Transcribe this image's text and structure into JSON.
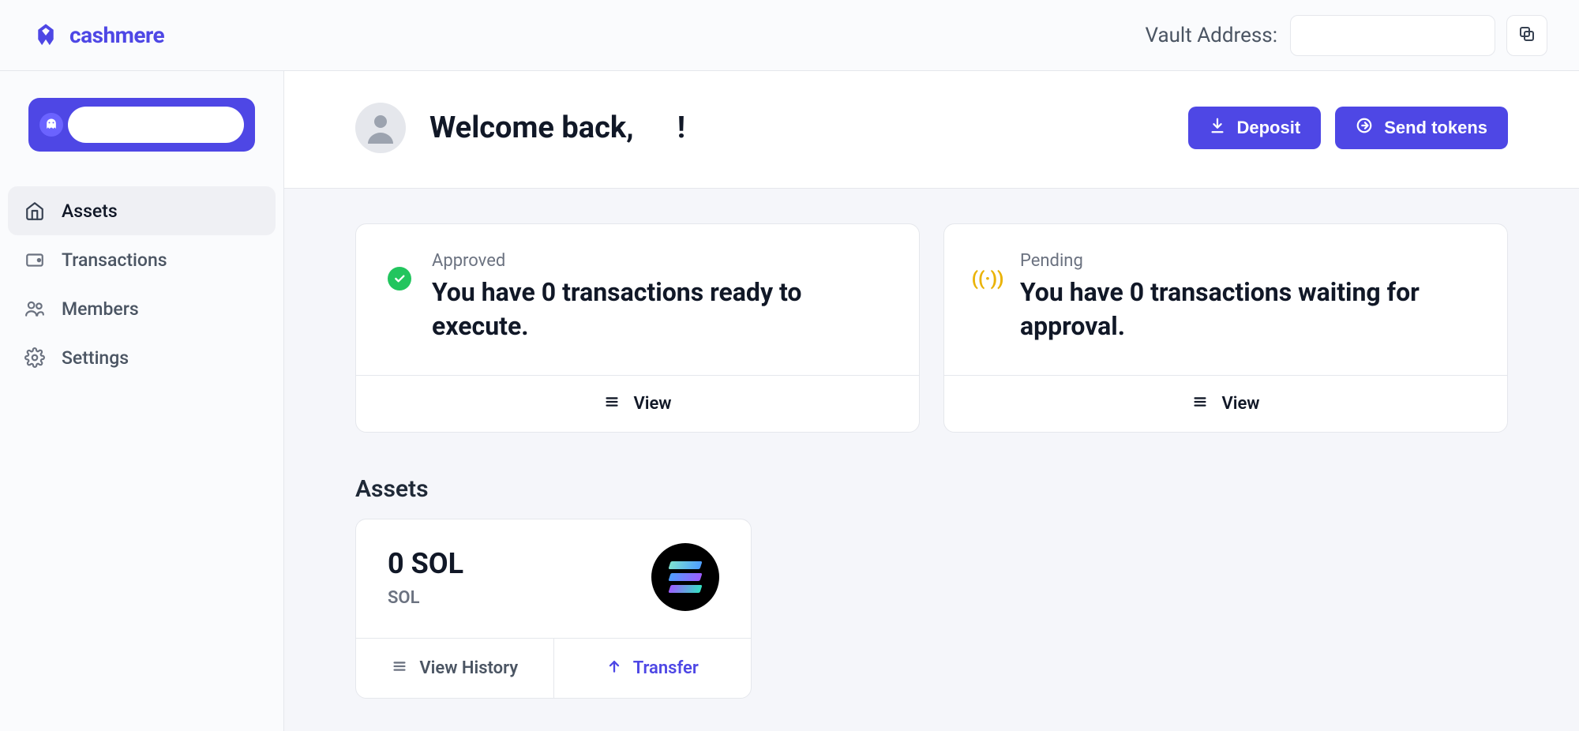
{
  "brand": {
    "name": "cashmere"
  },
  "topbar": {
    "vault_label": "Vault Address:",
    "vault_value": ""
  },
  "sidebar": {
    "items": [
      {
        "label": "Assets",
        "icon": "home-icon",
        "active": true
      },
      {
        "label": "Transactions",
        "icon": "wallet-icon",
        "active": false
      },
      {
        "label": "Members",
        "icon": "users-icon",
        "active": false
      },
      {
        "label": "Settings",
        "icon": "gear-icon",
        "active": false
      }
    ]
  },
  "welcome": {
    "greeting": "Welcome back,",
    "suffix": "!",
    "deposit_label": "Deposit",
    "send_label": "Send tokens"
  },
  "status_cards": {
    "approved": {
      "label": "Approved",
      "message": "You have 0 transactions ready to execute.",
      "action": "View"
    },
    "pending": {
      "label": "Pending",
      "message": "You have 0 transactions waiting for approval.",
      "action": "View"
    }
  },
  "assets_section": {
    "title": "Assets",
    "items": [
      {
        "amount": "0 SOL",
        "symbol": "SOL",
        "view_history_label": "View History",
        "transfer_label": "Transfer"
      }
    ]
  }
}
